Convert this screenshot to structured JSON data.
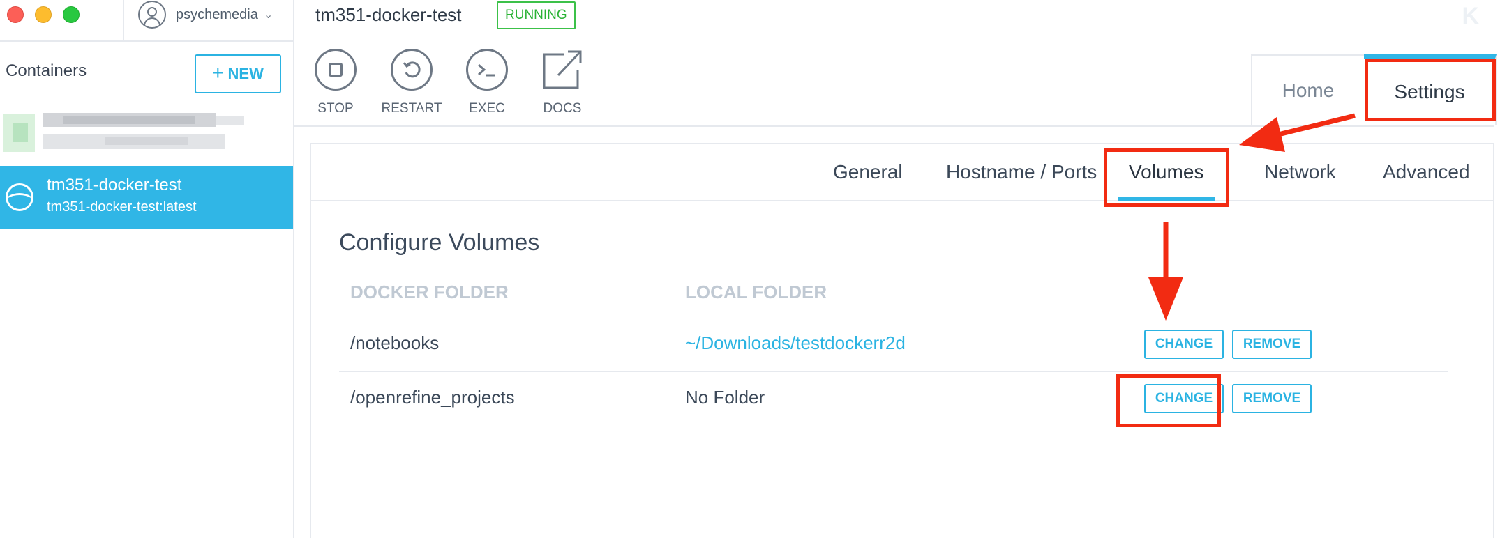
{
  "sidebar": {
    "user": "psychemedia",
    "containers_title": "Containers",
    "new_button": "NEW",
    "active_container": {
      "name": "tm351-docker-test",
      "image": "tm351-docker-test:latest"
    }
  },
  "header": {
    "title": "tm351-docker-test",
    "status": "RUNNING"
  },
  "toolbar": {
    "stop": "STOP",
    "restart": "RESTART",
    "exec": "EXEC",
    "docs": "DOCS"
  },
  "main_tabs": {
    "home": "Home",
    "settings": "Settings"
  },
  "settings_tabs": [
    "General",
    "Hostname / Ports",
    "Volumes",
    "Network",
    "Advanced"
  ],
  "volumes": {
    "title": "Configure Volumes",
    "col_docker": "DOCKER FOLDER",
    "col_local": "LOCAL FOLDER",
    "rows": [
      {
        "docker": "/notebooks",
        "local": "~/Downloads/testdockerr2d",
        "change": "CHANGE",
        "remove": "REMOVE"
      },
      {
        "docker": "/openrefine_projects",
        "local": "No Folder",
        "change": "CHANGE",
        "remove": "REMOVE"
      }
    ]
  },
  "colors": {
    "accent": "#30b6e6",
    "running": "#3cc149",
    "annotation": "#f22b12"
  }
}
